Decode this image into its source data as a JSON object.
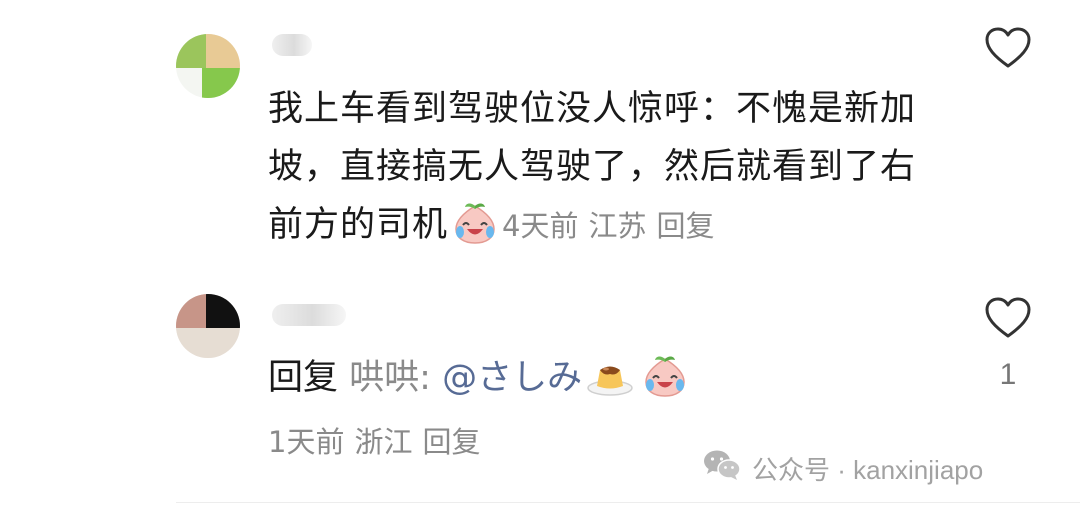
{
  "comments": [
    {
      "text": "我上车看到驾驶位没人惊呼：不愧是新加坡，直接搞无人驾驶了，然后就看到了右前方的司机",
      "emoji": "crying-laughing-peach-emoji",
      "time": "4天前",
      "location": "江苏",
      "reply_label": "回复"
    },
    {
      "reply_prefix": "回复",
      "reply_to": "哄哄:",
      "mention": "@さしみ",
      "emojis": [
        "pudding-emoji",
        "crying-laughing-peach-emoji"
      ],
      "time": "1天前",
      "location": "浙江",
      "reply_label": "回复",
      "like_count": "1"
    }
  ],
  "watermark": {
    "icon": "wechat-icon",
    "label": "公众号 · kanxinjiapo"
  },
  "colors": {
    "text": "#1a1a1a",
    "meta": "#8a8a8a",
    "mention": "#576b95",
    "heart_outline": "#333333"
  }
}
